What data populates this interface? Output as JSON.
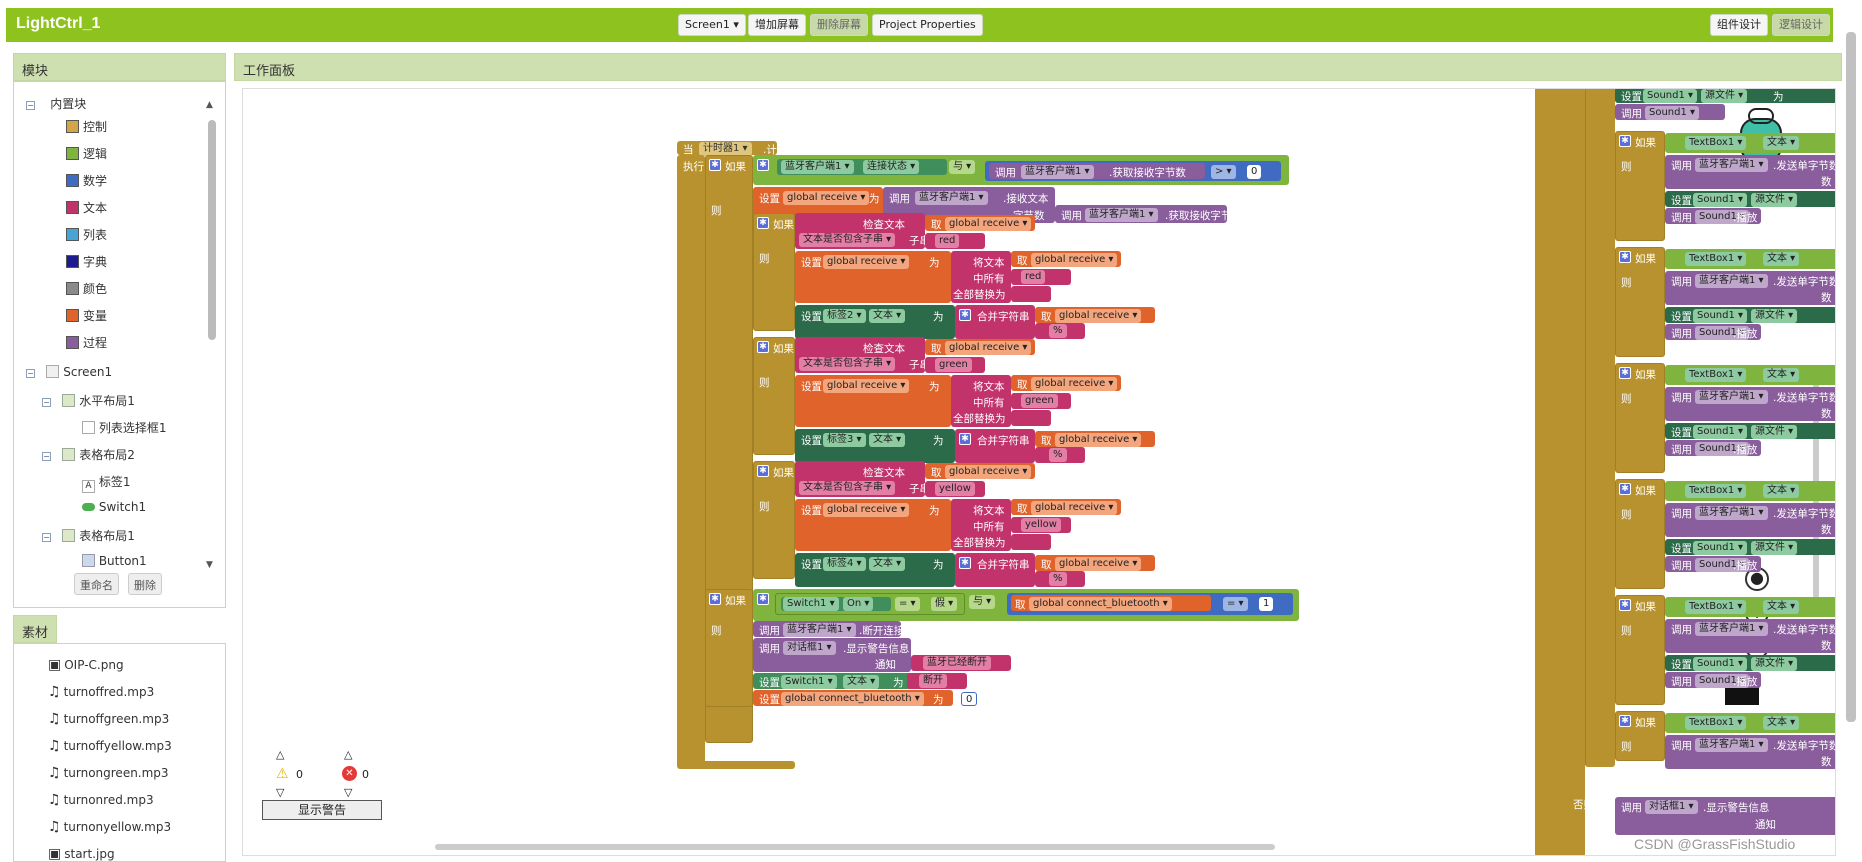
{
  "app": {
    "title": "LightCtrl_1"
  },
  "toolbar": {
    "screen_select": "Screen1 ▾",
    "add_screen": "增加屏幕",
    "remove_screen": "删除屏幕",
    "project_props": "Project Properties",
    "designer": "组件设计",
    "blocks": "逻辑设计"
  },
  "blocks_panel": {
    "header": "模块",
    "builtin": "内置块",
    "builtin_items": [
      {
        "label": "控制",
        "color": "#d4a546"
      },
      {
        "label": "逻辑",
        "color": "#7fb43e"
      },
      {
        "label": "数学",
        "color": "#3f6cc2"
      },
      {
        "label": "文本",
        "color": "#c2336b"
      },
      {
        "label": "列表",
        "color": "#46a5d6"
      },
      {
        "label": "字典",
        "color": "#1b1c8f"
      },
      {
        "label": "颜色",
        "color": "#8a8a8a"
      },
      {
        "label": "变量",
        "color": "#e0632b"
      },
      {
        "label": "过程",
        "color": "#8a5e9c"
      }
    ],
    "screen": "Screen1",
    "components": [
      "水平布局1",
      "列表选择框1",
      "表格布局2",
      "标签1",
      "Switch1",
      "表格布局1",
      "Button1"
    ],
    "rename": "重命名",
    "delete": "删除"
  },
  "media_panel": {
    "header": "素材",
    "items": [
      "OIP-C.png",
      "turnoffred.mp3",
      "turnoffgreen.mp3",
      "turnoffyellow.mp3",
      "turnongreen.mp3",
      "turnonred.mp3",
      "turnonyellow.mp3",
      "start.jpg"
    ]
  },
  "workspace": {
    "header": "工作面板",
    "warnings": "0",
    "errors": "0",
    "show_warnings": "显示警告",
    "watermark": "CSDN @GrassFishStudio"
  },
  "blocks": {
    "when": "当",
    "timer": "计时器1 ▾",
    "timer_evt": ".计时",
    "do": "执行",
    "if": "如果",
    "then": "则",
    "else": "否则",
    "bt_client": "蓝牙客户端1 ▾",
    "conn_state": "连接状态 ▾",
    "and": "与 ▾",
    "call": "调用",
    "bytes_avail": ".获取接收字节数",
    "gt": "> ▾",
    "zero": "0",
    "set": "设置",
    "global_receive": "global receive ▾",
    "to": "为",
    "recv_text": ".接收文本",
    "num_bytes": "字节数",
    "check_text": "检查文本",
    "get": "取",
    "contains": "文本是否包含子串 ▾",
    "piece": "子串",
    "red": "red",
    "green": "green",
    "yellow": "yellow",
    "replace_text": "将文本",
    "segment": "中所有",
    "replace_all": "全部替换为",
    "label2": "标签2 ▾",
    "label3": "标签3 ▾",
    "label4": "标签4 ▾",
    "text_prop": "文本 ▾",
    "join": "合并字符串",
    "percent": "%",
    "switch1": "Switch1 ▾",
    "on": "On ▾",
    "eq": "= ▾",
    "false": "假 ▾",
    "and2": "与 ▾",
    "global_conn": "global connect_bluetooth ▾",
    "one": "1",
    "disconnect": ".断开连接",
    "notifier": "对话框1 ▾",
    "show_alert": ".显示警告信息",
    "notice": "通知",
    "bt_disconnected": "蓝牙已经断开",
    "switch_off": "断开",
    "global_conn2": "global connect_bluetooth ▾",
    "zero2": "0",
    "sound1": "Sound1 ▾",
    "source": "源文件 ▾",
    "play": ".播放",
    "textbox1": "TextBox1 ▾",
    "send_num": ".发送单字节数",
    "num": "数"
  }
}
